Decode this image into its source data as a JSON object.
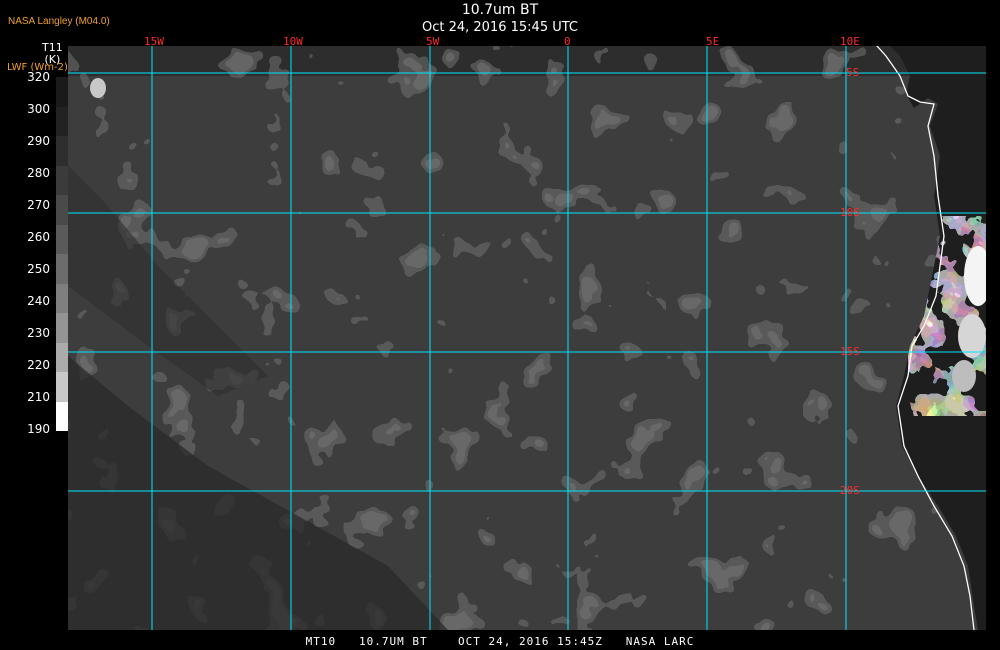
{
  "header": {
    "credit": "NASA Langley (M04.0)",
    "title": "10.7um BT",
    "subtitle": "Oct 24, 2016 15:45 UTC"
  },
  "legend": {
    "variable": "T11",
    "variable_unit": "(K)",
    "alt_unit": "LWF (Wm-2)",
    "ticks": [
      "320",
      "300",
      "290",
      "280",
      "270",
      "260",
      "250",
      "240",
      "230",
      "220",
      "210",
      "190"
    ],
    "grayscale": [
      "#1a1a1a",
      "#222222",
      "#2e2e2e",
      "#3b3b3b",
      "#4a4a4a",
      "#5a5a5a",
      "#6c6c6c",
      "#7f7f7f",
      "#949494",
      "#ababab",
      "#c8c8c8",
      "#ffffff"
    ]
  },
  "map": {
    "longitude_labels": [
      "15W",
      "10W",
      "5W",
      "0",
      "5E",
      "10E"
    ],
    "latitude_labels": [
      "5S",
      "10S",
      "15S",
      "20S"
    ],
    "grid_color": "#00e5ff",
    "label_color": "#ff2a2a",
    "coast_color": "#ffffff"
  },
  "footer": {
    "text": "MT10   10.7UM BT    OCT 24, 2016 15:45Z   NASA LARC"
  }
}
